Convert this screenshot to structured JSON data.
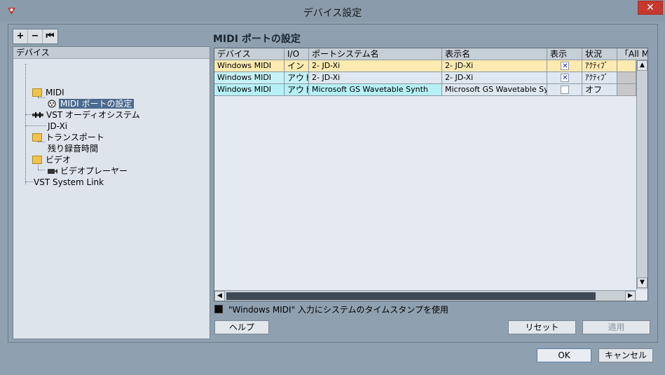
{
  "window": {
    "title": "デバイス設定",
    "close_glyph": "✕"
  },
  "toolbar": {
    "add_glyph": "+",
    "remove_glyph": "−",
    "reset_glyph": "⏮"
  },
  "tree": {
    "header": "デバイス",
    "items": [
      {
        "label": "MIDI",
        "icon": "folder-icon"
      },
      {
        "label": "MIDI ポートの設定",
        "icon": "midi-port-icon"
      },
      {
        "label": "VST オーディオシステム",
        "icon": "audio-system-icon"
      },
      {
        "label": "JD-Xi",
        "icon": "none"
      },
      {
        "label": "トランスポート",
        "icon": "folder-icon"
      },
      {
        "label": "残り録音時間",
        "icon": "none"
      },
      {
        "label": "ビデオ",
        "icon": "folder-icon"
      },
      {
        "label": "ビデオプレーヤー",
        "icon": "video-player-icon"
      },
      {
        "label": "VST System Link",
        "icon": "none"
      }
    ]
  },
  "panel": {
    "title": "MIDI ポートの設定"
  },
  "table": {
    "columns": [
      "デバイス",
      "I/O",
      "ポートシステム名",
      "表示名",
      "表示",
      "状況",
      "「All MI"
    ],
    "rows": [
      {
        "device": "Windows MIDI",
        "io": "イン",
        "port": "2- JD-Xi",
        "display": "2- JD-Xi",
        "visible": true,
        "status": "ｱｸﾃｨﾌﾞ",
        "color": "#fdeab0"
      },
      {
        "device": "Windows MIDI",
        "io": "アウト",
        "port": "2- JD-Xi",
        "display": "2- JD-Xi",
        "visible": true,
        "status": "ｱｸﾃｨﾌﾞ",
        "color": "#c5f2f6"
      },
      {
        "device": "Windows MIDI",
        "io": "アウト",
        "port": "Microsoft GS Wavetable Synth",
        "display": "Microsoft GS Wavetable Synth",
        "visible": false,
        "status": "オフ",
        "color": "#b6f0f6"
      }
    ]
  },
  "timestamp_option": {
    "label": "\"Windows MIDI\" 入力にシステムのタイムスタンプを使用",
    "checked": true
  },
  "buttons": {
    "help": "ヘルプ",
    "reset": "リセット",
    "apply": "適用",
    "ok": "OK",
    "cancel": "キャンセル"
  },
  "colors": {
    "selection": "#4b6a8d",
    "in_row": "#fdeab0",
    "out_row": "#c5f2f6"
  }
}
